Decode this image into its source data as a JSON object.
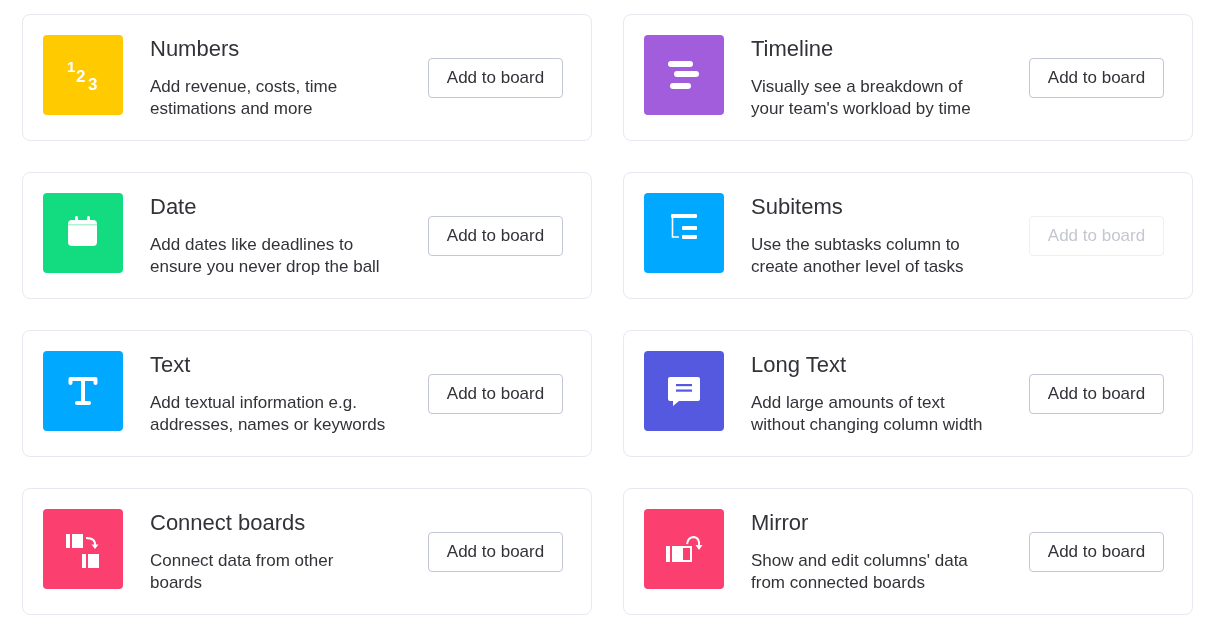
{
  "columns": [
    {
      "kind": "numbers",
      "color": "#ffcb00",
      "icon_text": "123",
      "title": "Numbers",
      "description": "Add revenue, costs, time estimations and more",
      "button": {
        "label": "Add to board",
        "disabled": false
      }
    },
    {
      "kind": "timeline",
      "color": "#a25ddc",
      "title": "Timeline",
      "description": "Visually see a breakdown of your team's workload by time",
      "button": {
        "label": "Add to board",
        "disabled": false
      }
    },
    {
      "kind": "date",
      "color": "#13dc80",
      "title": "Date",
      "description": "Add dates like deadlines to ensure you never drop the ball",
      "button": {
        "label": "Add to board",
        "disabled": false
      }
    },
    {
      "kind": "subitems",
      "color": "#00a9ff",
      "title": "Subitems",
      "description": "Use the subtasks column to create another level of tasks",
      "button": {
        "label": "Add to board",
        "disabled": true
      }
    },
    {
      "kind": "text",
      "color": "#00a9ff",
      "title": "Text",
      "description": "Add textual information e.g. addresses, names or keywords",
      "button": {
        "label": "Add to board",
        "disabled": false
      }
    },
    {
      "kind": "long_text",
      "color": "#5559df",
      "title": "Long Text",
      "description": "Add large amounts of text without changing column width",
      "button": {
        "label": "Add to board",
        "disabled": false
      }
    },
    {
      "kind": "connect",
      "color": "#fb3f6f",
      "title": "Connect boards",
      "description": "Connect data from other boards",
      "button": {
        "label": "Add to board",
        "disabled": false
      }
    },
    {
      "kind": "mirror",
      "color": "#fb3f6f",
      "title": "Mirror",
      "description": "Show and edit columns' data from connected boards",
      "button": {
        "label": "Add to board",
        "disabled": false
      }
    }
  ]
}
